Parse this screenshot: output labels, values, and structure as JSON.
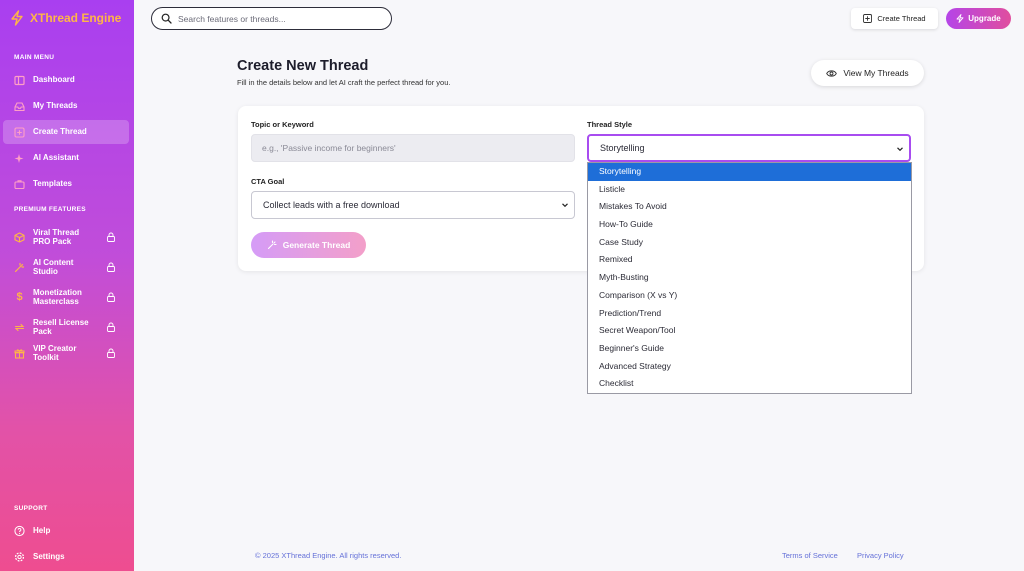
{
  "brand": {
    "name": "XThread Engine",
    "logo_icon": "lightning-bolt-icon",
    "logo_color": "#ffb547"
  },
  "sidebar": {
    "main_menu_label": "MAIN MENU",
    "main_items": [
      {
        "label": "Dashboard",
        "icon": "layout-icon"
      },
      {
        "label": "My Threads",
        "icon": "inbox-icon"
      },
      {
        "label": "Create Thread",
        "icon": "plus-square-icon",
        "active": true
      },
      {
        "label": "AI Assistant",
        "icon": "sparkles-icon"
      },
      {
        "label": "Templates",
        "icon": "briefcase-icon"
      }
    ],
    "premium_label": "PREMIUM FEATURES",
    "premium_items": [
      {
        "label": "Viral Thread PRO Pack",
        "icon": "package-icon"
      },
      {
        "label": "AI Content Studio",
        "icon": "wand-icon"
      },
      {
        "label": "Monetization Masterclass",
        "icon": "dollar-icon"
      },
      {
        "label": "Resell License Pack",
        "icon": "repeat-icon"
      },
      {
        "label": "VIP Creator Toolkit",
        "icon": "gift-icon"
      }
    ],
    "support_label": "SUPPORT",
    "support_items": [
      {
        "label": "Help",
        "icon": "help-circle-icon"
      },
      {
        "label": "Settings",
        "icon": "gear-icon"
      }
    ]
  },
  "topbar": {
    "search_placeholder": "Search features or threads...",
    "create_label": "Create Thread",
    "upgrade_label": "Upgrade"
  },
  "page": {
    "title": "Create New Thread",
    "subtitle": "Fill in the details below and let AI craft the perfect thread for you.",
    "view_label": "View My Threads"
  },
  "form": {
    "topic_label": "Topic or Keyword",
    "topic_placeholder": "e.g., 'Passive income for beginners'",
    "cta_label": "CTA Goal",
    "cta_value": "Collect leads with a free download",
    "style_label": "Thread Style",
    "style_value": "Storytelling",
    "style_options": [
      "Storytelling",
      "Listicle",
      "Mistakes To Avoid",
      "How-To Guide",
      "Case Study",
      "Remixed",
      "Myth-Busting",
      "Comparison (X vs Y)",
      "Prediction/Trend",
      "Secret Weapon/Tool",
      "Beginner's Guide",
      "Advanced Strategy",
      "Checklist"
    ],
    "generate_label": "Generate Thread"
  },
  "footer": {
    "copyright": "© 2025 XThread Engine. All rights reserved.",
    "terms": "Terms of Service",
    "privacy": "Privacy Policy"
  },
  "colors": {
    "accent": "#a84cf0",
    "selected_option": "#1e6ed8",
    "link": "#6571d8"
  }
}
